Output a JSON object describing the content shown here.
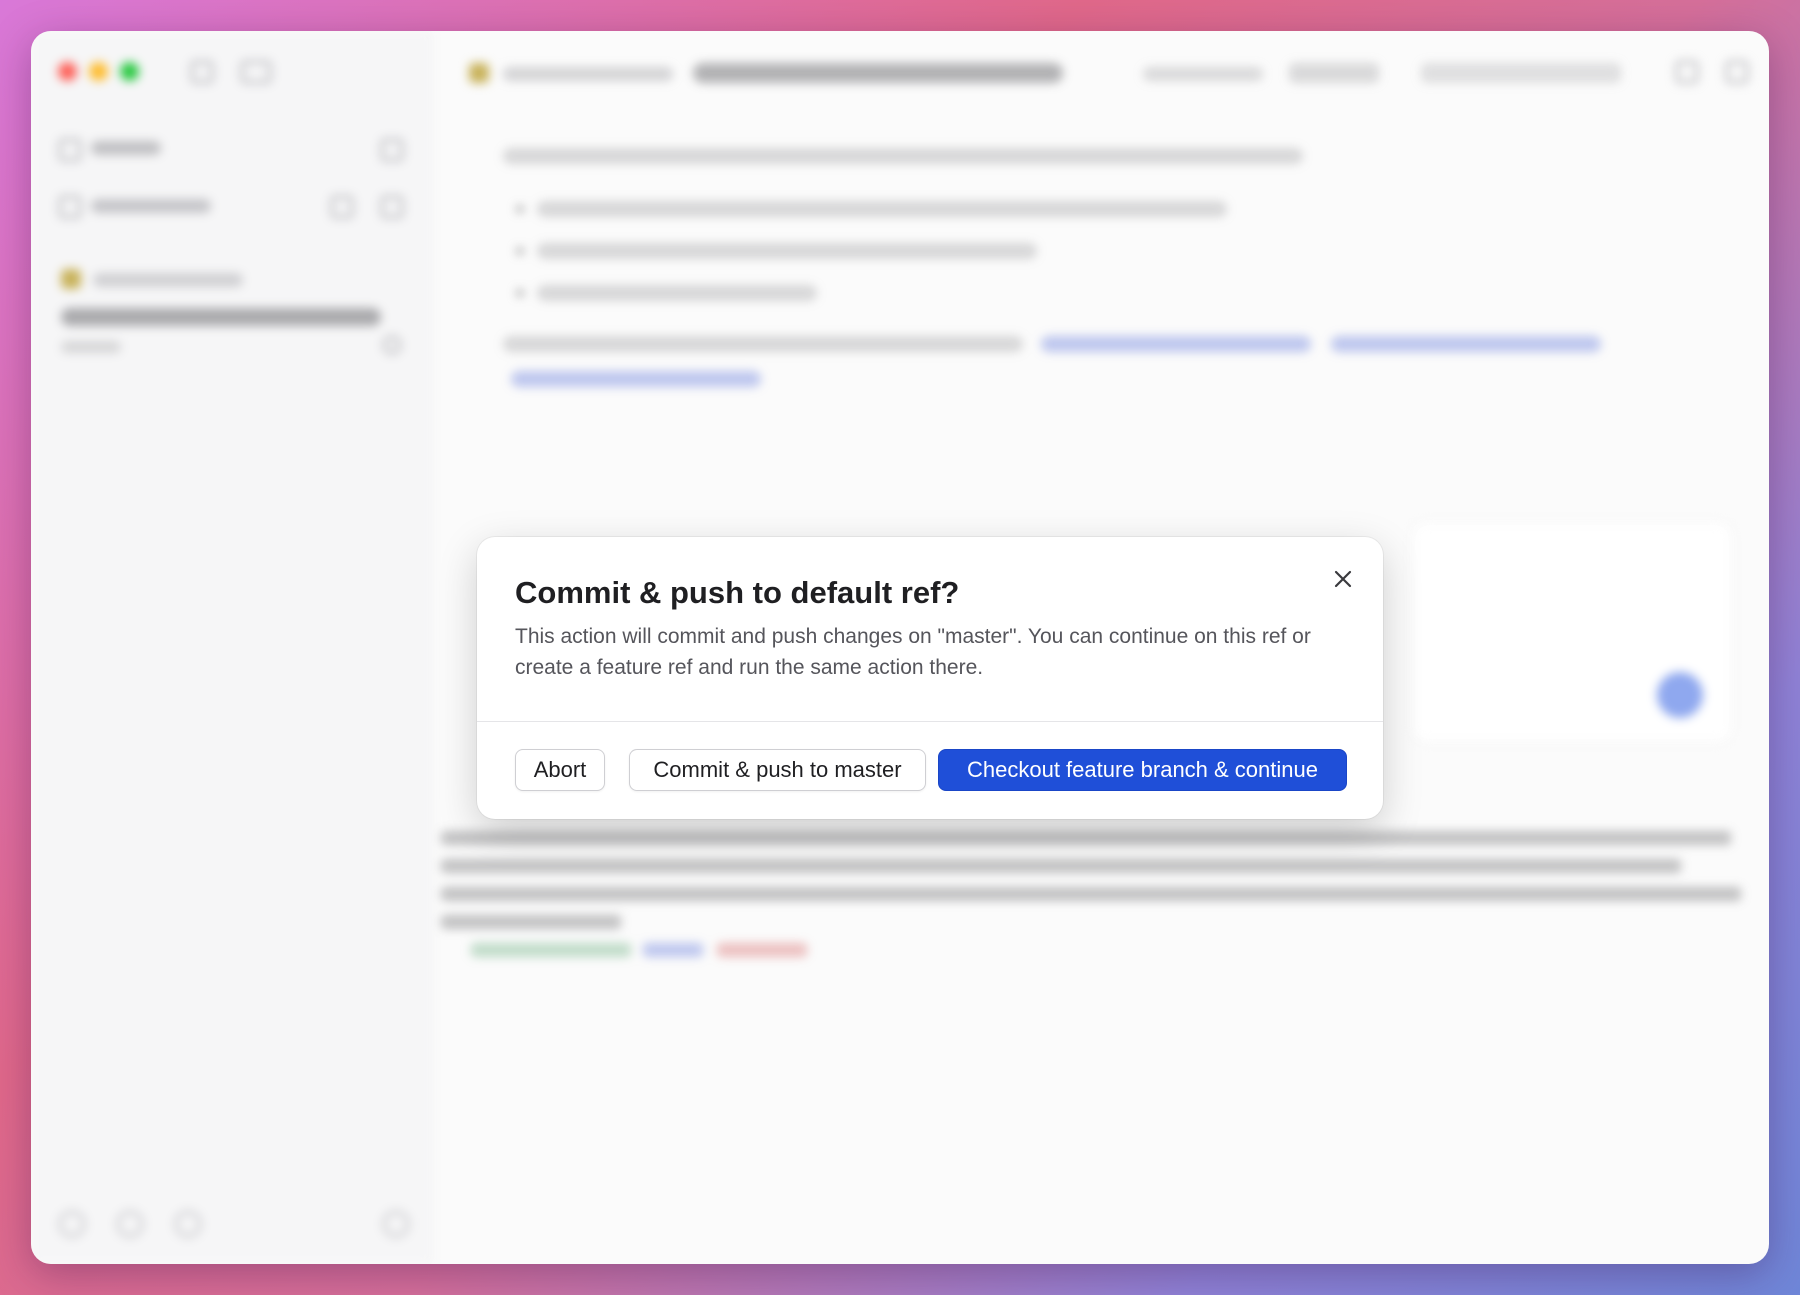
{
  "dialog": {
    "title": "Commit & push to default ref?",
    "body": "This action will commit and push changes on \"master\". You can continue on this ref or create a feature ref and run the same action there.",
    "buttons": {
      "abort": "Abort",
      "commit_push": "Commit & push to master",
      "checkout": "Checkout feature branch & continue"
    },
    "close_icon": "close-icon"
  },
  "colors": {
    "primary_button": "#1f4fd8",
    "traffic_red": "#fe5f57",
    "traffic_yellow": "#febc2e",
    "traffic_green": "#28c840"
  }
}
